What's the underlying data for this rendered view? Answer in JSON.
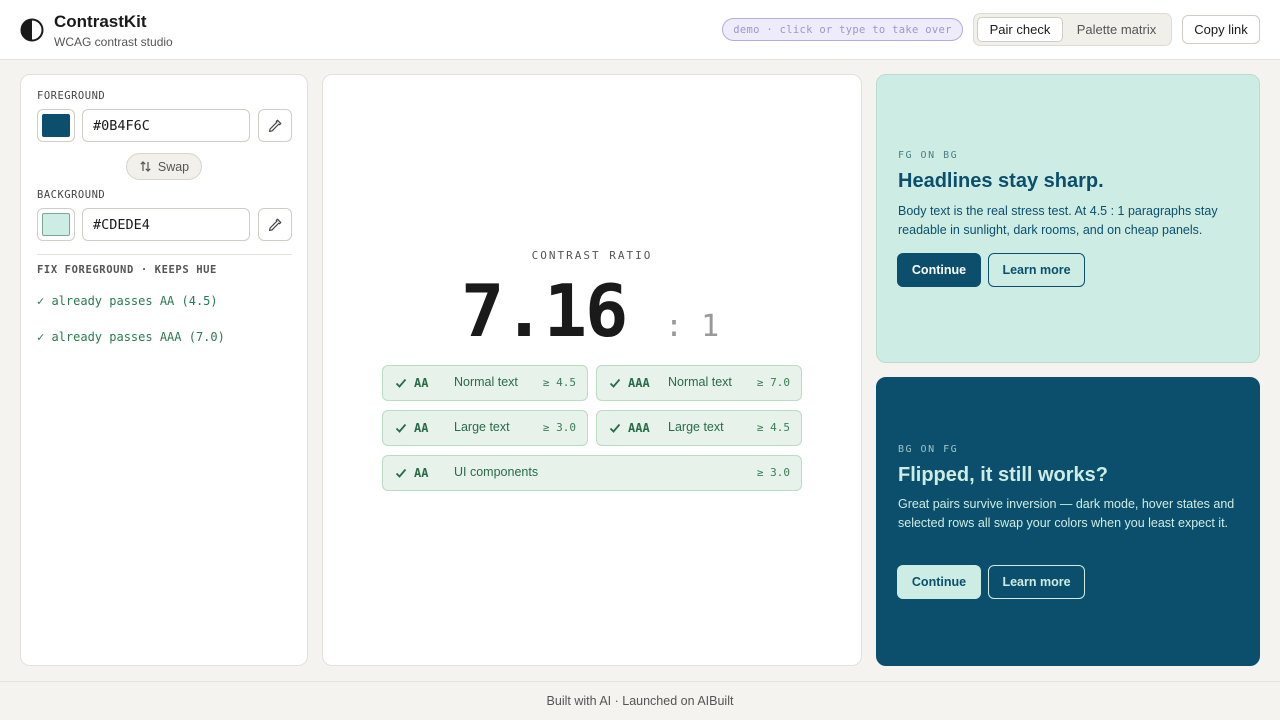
{
  "header": {
    "brand_title": "ContrastKit",
    "brand_subtitle": "WCAG contrast studio",
    "demo_pill": "demo · click or type to take over",
    "tabs": [
      {
        "label": "Pair check",
        "active": true
      },
      {
        "label": "Palette matrix",
        "active": false
      }
    ],
    "copy_link_label": "Copy link"
  },
  "sidebar": {
    "foreground_label": "FOREGROUND",
    "foreground_value": "#0B4F6C",
    "foreground_color": "#0b4f6c",
    "swap_label": "Swap",
    "background_label": "BACKGROUND",
    "background_value": "#CDEDE4",
    "background_color": "#cdede4",
    "fix_title": "FIX FOREGROUND · KEEPS HUE",
    "fix_lines": [
      "✓ already passes AA (4.5)",
      "✓ already passes AAA (7.0)"
    ]
  },
  "result": {
    "ratio_label": "CONTRAST RATIO",
    "ratio_value": "7.16",
    "ratio_suffix": ": 1",
    "badges": [
      {
        "level": "AA",
        "kind": "Normal text",
        "min": "≥ 4.5",
        "pass": true
      },
      {
        "level": "AAA",
        "kind": "Normal text",
        "min": "≥ 7.0",
        "pass": true
      },
      {
        "level": "AA",
        "kind": "Large text",
        "min": "≥ 3.0",
        "pass": true
      },
      {
        "level": "AAA",
        "kind": "Large text",
        "min": "≥ 4.5",
        "pass": true
      },
      {
        "level": "AA",
        "kind": "UI components",
        "min": "≥ 3.0",
        "pass": true
      }
    ]
  },
  "previews": {
    "fg_on_bg": {
      "eyebrow": "FG ON BG",
      "headline": "Headlines stay sharp.",
      "body": "Body text is the real stress test. At 4.5 : 1 paragraphs stay readable in sunlight, dark rooms, and on cheap panels.",
      "primary_label": "Continue",
      "secondary_label": "Learn more"
    },
    "bg_on_fg": {
      "eyebrow": "BG ON FG",
      "headline": "Flipped, it still works?",
      "body": "Great pairs survive inversion — dark mode, hover states and selected rows all swap your colors when you least expect it.",
      "primary_label": "Continue",
      "secondary_label": "Learn more"
    }
  },
  "footer": {
    "text": "Built with AI · Launched on AIBuilt"
  },
  "icons": [
    "half-circle-logo-icon",
    "eyedropper-icon",
    "swap-arrows-icon",
    "check-icon"
  ]
}
